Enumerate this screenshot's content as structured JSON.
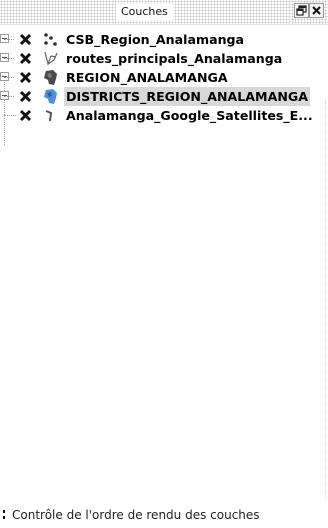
{
  "panel": {
    "title": "Couches",
    "float_icon": "float-window-icon",
    "close_icon": "close-icon"
  },
  "layers": [
    {
      "label": "CSB_Region_Analamanga",
      "icon": "point-layer-icon",
      "checked": true,
      "expander": true,
      "selected": false
    },
    {
      "label": "routes_principals_Analamanga",
      "icon": "line-layer-icon",
      "checked": true,
      "expander": true,
      "selected": false
    },
    {
      "label": "REGION_ANALAMANGA",
      "icon": "polygon-layer-icon",
      "checked": true,
      "expander": true,
      "selected": false
    },
    {
      "label": "DISTRICTS_REGION_ANALAMANGA",
      "icon": "polygon-layer-icon",
      "checked": true,
      "expander": true,
      "selected": true
    },
    {
      "label": "Analamanga_Google_Satellites_E...",
      "icon": "raster-layer-icon",
      "checked": true,
      "expander": false,
      "selected": false
    }
  ],
  "footer": {
    "label": "Contrôle de l'ordre de rendu des couches",
    "checked": true
  },
  "colors": {
    "selection": "#d8d8d8",
    "polygon_fill": "#4a4a4a",
    "polygon_highlight": "#4f8fd6"
  }
}
